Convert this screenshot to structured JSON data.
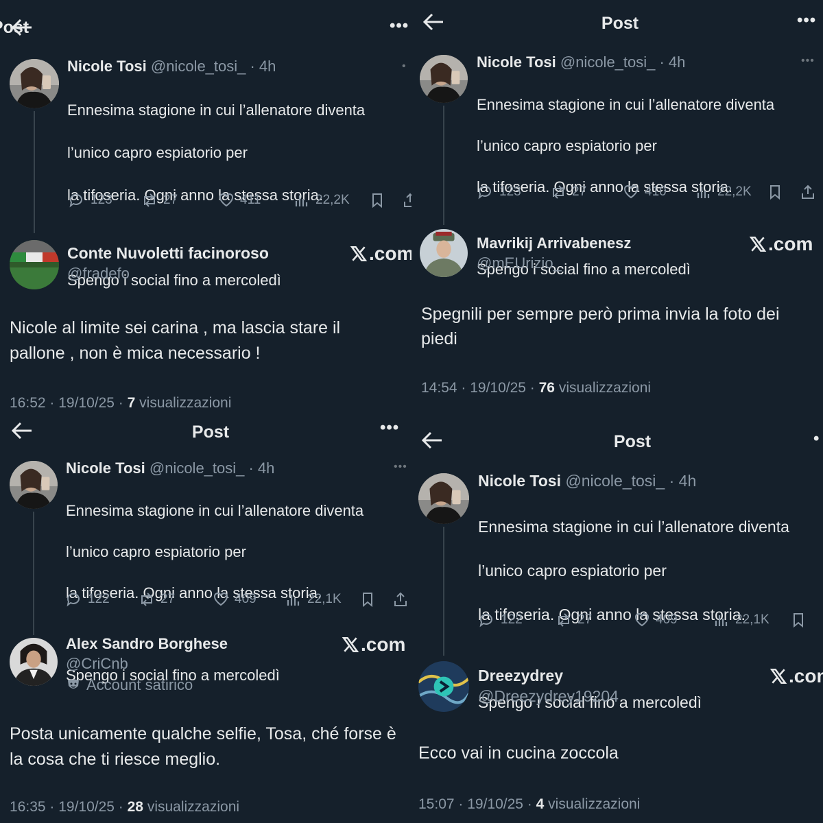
{
  "header": {
    "title": "Post"
  },
  "original_post": {
    "name": "Nicole Tosi",
    "handle_time": "@nicole_tosi_ · 4h",
    "line1": "Ennesima stagione in cui l’allenatore diventa",
    "line2": "l’unico capro espiatorio per",
    "line3": "la tifoseria. Ogni anno la stessa storia.",
    "line4": "Spengo i social fino a mercoledì"
  },
  "brand": {
    "label": ".com",
    "icon": "x-logo-icon"
  },
  "satire_badge": {
    "icon": "theater-mask-icon"
  },
  "panels": [
    {
      "stats": {
        "replies": "123",
        "reposts": "27",
        "likes": "411",
        "views": "22,2K"
      },
      "reply": {
        "name": "Conte Nuvoletti facinoroso",
        "handle": "@fradefo",
        "text": "Nicole al limite sei carina , ma lascia stare il pallone , non è mica necessario !",
        "time_date": "16:52 · 19/10/25 · ",
        "views_count": "7",
        "views_label": " visualizzazioni"
      }
    },
    {
      "stats": {
        "replies": "123",
        "reposts": "27",
        "likes": "410",
        "views": "22,2K"
      },
      "reply": {
        "name": "Mavrikij Arrivabenesz",
        "handle": "@mEUrizio_",
        "text": "Spegnili per sempre però prima invia la foto dei piedi",
        "time_date": "14:54 · 19/10/25 · ",
        "views_count": "76",
        "views_label": " visualizzazioni"
      }
    },
    {
      "stats": {
        "replies": "122",
        "reposts": "27",
        "likes": "409",
        "views": "22,1K"
      },
      "reply": {
        "name": "Alex Sandro Borghese",
        "handle": "@CriCnb",
        "badge": "Account satirico",
        "text": "Posta unicamente qualche selfie, Tosa, ché forse è la cosa che ti riesce meglio.",
        "time_date": "16:35 · 19/10/25 · ",
        "views_count": "28",
        "views_label": " visualizzazioni"
      }
    },
    {
      "stats": {
        "replies": "122",
        "reposts": "27",
        "likes": "409",
        "views": "22,1K"
      },
      "reply": {
        "name": "Dreezydrey",
        "handle": "@Dreezydrey19204",
        "text": "Ecco vai in cucina zoccola",
        "time_date": "15:07 · 19/10/25 · ",
        "views_count": "4",
        "views_label": " visualizzazioni"
      }
    }
  ]
}
